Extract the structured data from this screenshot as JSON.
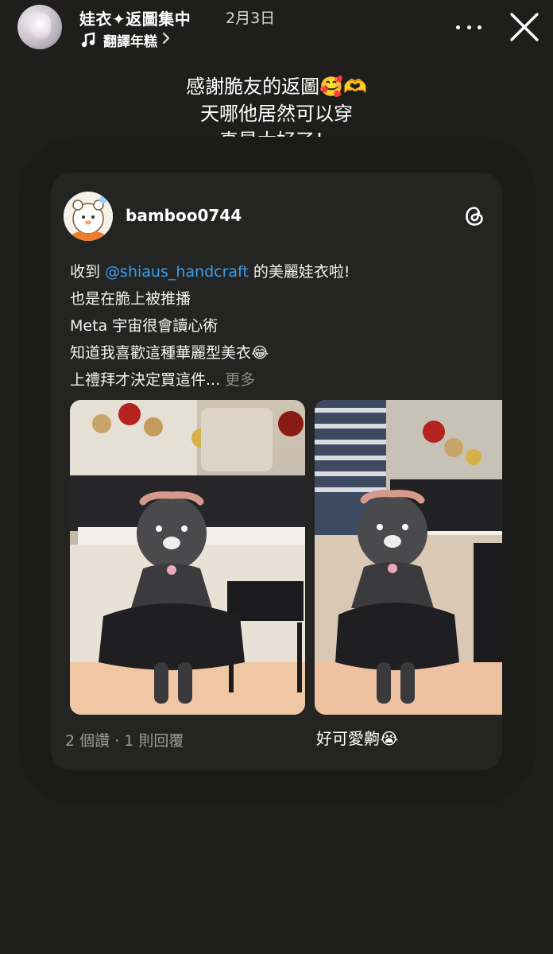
{
  "header": {
    "user_name": "娃衣✦返圖集中",
    "date": "2月3日",
    "music_label": "翻譯年糕"
  },
  "caption": {
    "lines": [
      "感謝脆友的返圖🥰🫶",
      "天哪他居然可以穿",
      "真是太好了！"
    ]
  },
  "post": {
    "username": "bamboo0744",
    "text": {
      "line1_prefix": "收到 ",
      "mention": "@shiaus_handcraft",
      "line1_suffix": " 的美麗娃衣啦!",
      "line2": "也是在脆上被推播",
      "line3": "Meta 宇宙很會讀心術",
      "line4": "知道我喜歡這種華麗型美衣😂",
      "line5": "上禮拜才決定買這件...",
      "more": " 更多"
    },
    "likes": "2 個讚 · 1 則回覆",
    "reply": "好可愛齁😭"
  },
  "icons": {
    "music": "music-note-icon",
    "chevron": "chevron-right-icon",
    "more": "more-horizontal-icon",
    "close": "close-icon",
    "threads": "threads-logo-icon"
  },
  "colors": {
    "background": "#1e1e1c",
    "card": "#242422",
    "mention": "#3e9df0",
    "muted": "#9a9a9a"
  }
}
